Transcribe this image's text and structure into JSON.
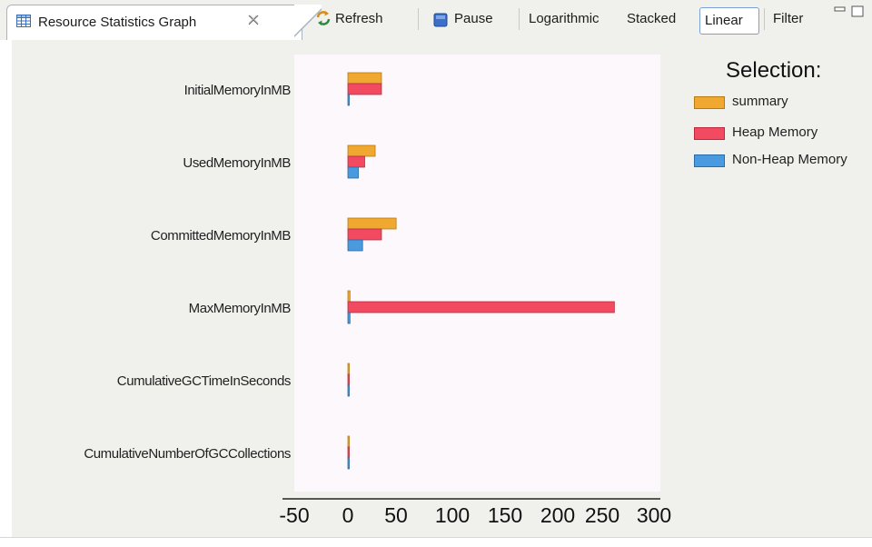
{
  "tab": {
    "title": "Resource Statistics Graph"
  },
  "toolbar": {
    "refresh": "Refresh",
    "pause": "Pause",
    "logarithmic": "Logarithmic",
    "stacked": "Stacked",
    "linear": "Linear",
    "filter": "Filter"
  },
  "legend": {
    "title": "Selection:"
  },
  "colors": {
    "summary": "#f0a830",
    "heap": "#f24a60",
    "nonheap": "#4a9ae0",
    "plot_bg": "#fdf8fb"
  },
  "chart_data": {
    "type": "bar",
    "orientation": "horizontal",
    "categories": [
      "InitialMemoryInMB",
      "UsedMemoryInMB",
      "CommittedMemoryInMB",
      "MaxMemoryInMB",
      "CumulativeGCTimeInSeconds",
      "CumulativeNumberOfGCCollections"
    ],
    "series": [
      {
        "name": "summary",
        "values": [
          32,
          26,
          46,
          2,
          0,
          0
        ]
      },
      {
        "name": "Heap Memory",
        "values": [
          32,
          16,
          32,
          254,
          0,
          0
        ]
      },
      {
        "name": "Non-Heap Memory",
        "values": [
          0.5,
          10,
          14,
          2,
          0,
          0
        ]
      }
    ],
    "xticks": [
      "-50",
      "0",
      "50",
      "100",
      "150",
      "200",
      "250",
      "300"
    ],
    "xlim": [
      -50,
      300
    ],
    "legend_position": "right"
  }
}
